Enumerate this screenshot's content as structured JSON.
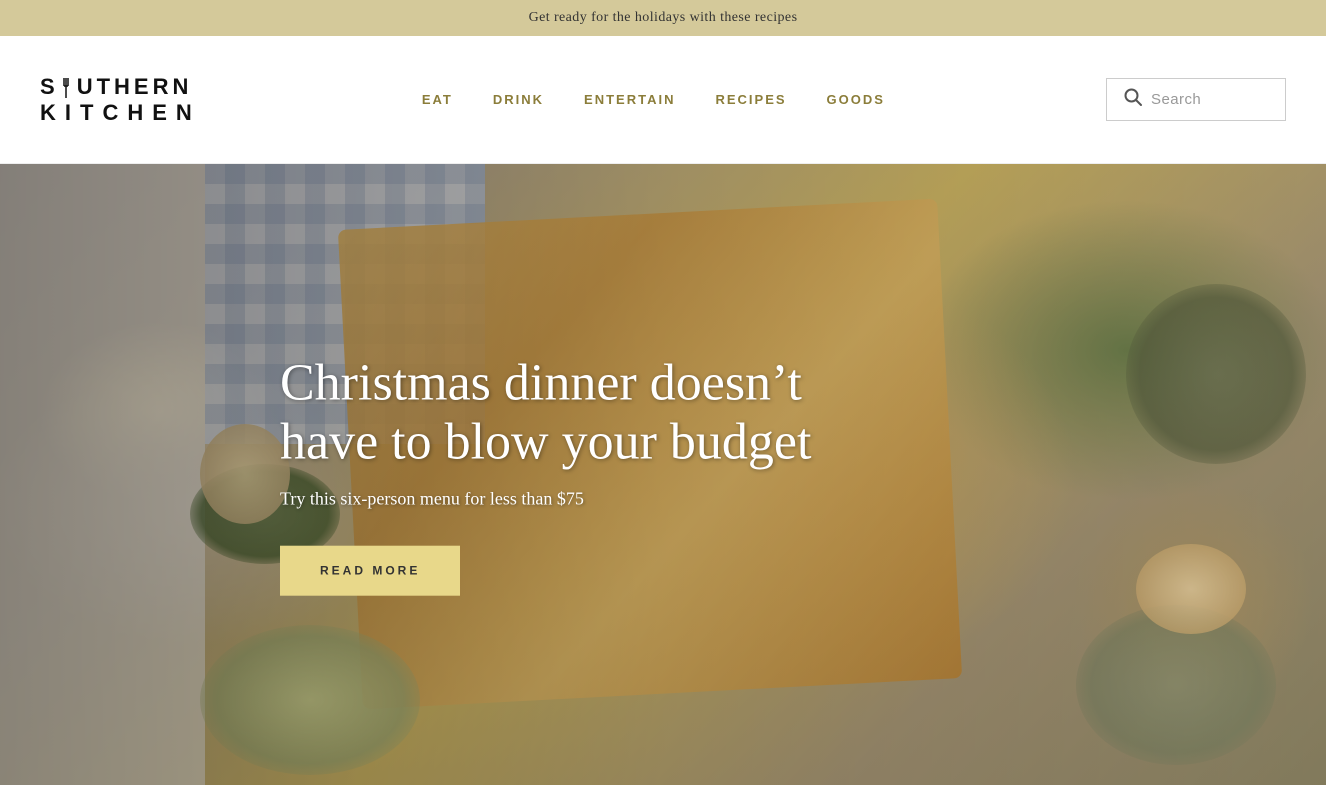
{
  "banner": {
    "text": "Get ready for the holidays with these recipes"
  },
  "header": {
    "logo_line1": "SOUTHERN",
    "logo_line2": "KITCHEN",
    "nav_items": [
      {
        "label": "EAT",
        "id": "eat"
      },
      {
        "label": "DRINK",
        "id": "drink"
      },
      {
        "label": "ENTERTAIN",
        "id": "entertain"
      },
      {
        "label": "RECIPES",
        "id": "recipes"
      },
      {
        "label": "GOODS",
        "id": "goods"
      }
    ],
    "search_placeholder": "Search"
  },
  "hero": {
    "title": "Christmas dinner doesn’t have to blow your budget",
    "subtitle": "Try this six-person menu for less than $75",
    "cta_label": "READ MORE"
  }
}
